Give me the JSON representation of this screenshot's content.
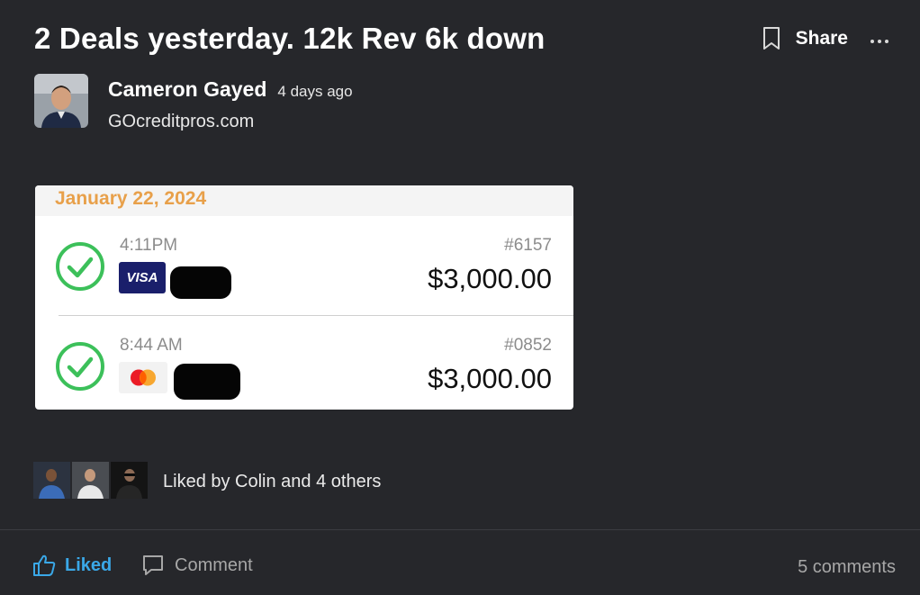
{
  "post": {
    "title": "2 Deals yesterday. 12k Rev 6k down",
    "share_label": "Share",
    "author": {
      "name": "Cameron Gayed",
      "time": "4 days ago",
      "site": "GOcreditpros.com"
    }
  },
  "receipt": {
    "date": "January 22, 2024",
    "transactions": [
      {
        "time": "4:11PM",
        "number": "#6157",
        "amount": "$3,000.00",
        "card": "VISA"
      },
      {
        "time": "8:44 AM",
        "number": "#0852",
        "amount": "$3,000.00",
        "card": "mastercard"
      }
    ]
  },
  "likes": {
    "text": "Liked by Colin and 4 others"
  },
  "actions": {
    "like_label": "Liked",
    "comment_label": "Comment",
    "comments_count": "5 comments"
  },
  "colors": {
    "background": "#26272b",
    "accent": "#3aa8e8",
    "date_orange": "#e8a04a",
    "check_green": "#3cc05a"
  },
  "icons": [
    "bookmark-icon",
    "more-icon",
    "check-icon",
    "visa-logo",
    "mastercard-logo",
    "thumbs-up-icon",
    "comment-icon"
  ]
}
